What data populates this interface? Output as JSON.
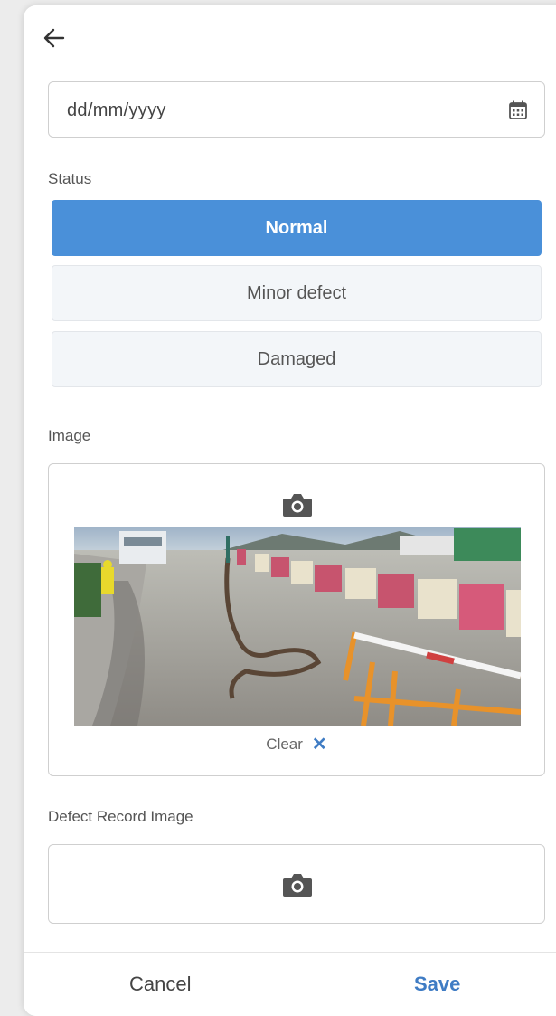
{
  "header": {
    "back_icon": "arrow-left-icon"
  },
  "date": {
    "placeholder": "dd/mm/yyyy",
    "icon": "calendar-icon"
  },
  "status": {
    "label": "Status",
    "options": [
      "Normal",
      "Minor defect",
      "Damaged"
    ],
    "selected": "Normal"
  },
  "image": {
    "label": "Image",
    "camera_icon": "camera-icon",
    "clear_label": "Clear",
    "clear_icon": "close-icon"
  },
  "defect_record": {
    "label": "Defect Record Image",
    "camera_icon": "camera-icon"
  },
  "footer": {
    "cancel_label": "Cancel",
    "save_label": "Save"
  },
  "colors": {
    "accent": "#4a90d9",
    "link": "#3f7cc4"
  }
}
